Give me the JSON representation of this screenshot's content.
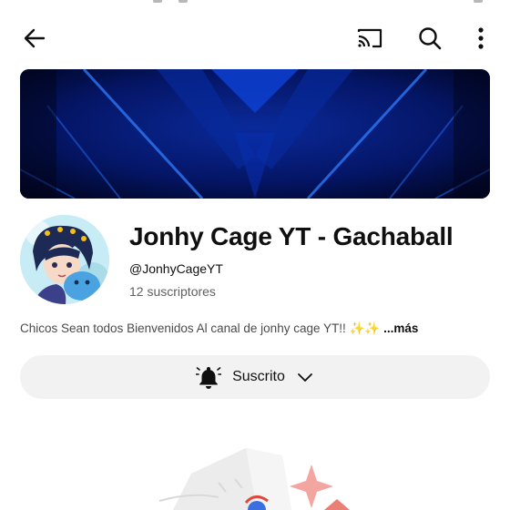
{
  "icons": {
    "back": "arrow-left-icon",
    "cast": "cast-icon",
    "search": "search-icon",
    "more": "more-vert-icon",
    "bell": "bell-icon",
    "chevron": "chevron-down-icon"
  },
  "channel": {
    "title": "Jonhy Cage YT - Gachaball",
    "handle": "@JonhyCageYT",
    "subscribers": "12 suscriptores",
    "description": "Chicos Sean todos Bienvenidos Al canal de jonhy cage YT!! ",
    "description_emoji": "✨✨",
    "more_label": "...más"
  },
  "subscribe_button": {
    "label": "Suscrito"
  },
  "colors": {
    "banner": "#020a3a",
    "banner_accent": "#1e6fff",
    "button_bg": "#f2f2f2",
    "secondary_text": "#606060"
  }
}
